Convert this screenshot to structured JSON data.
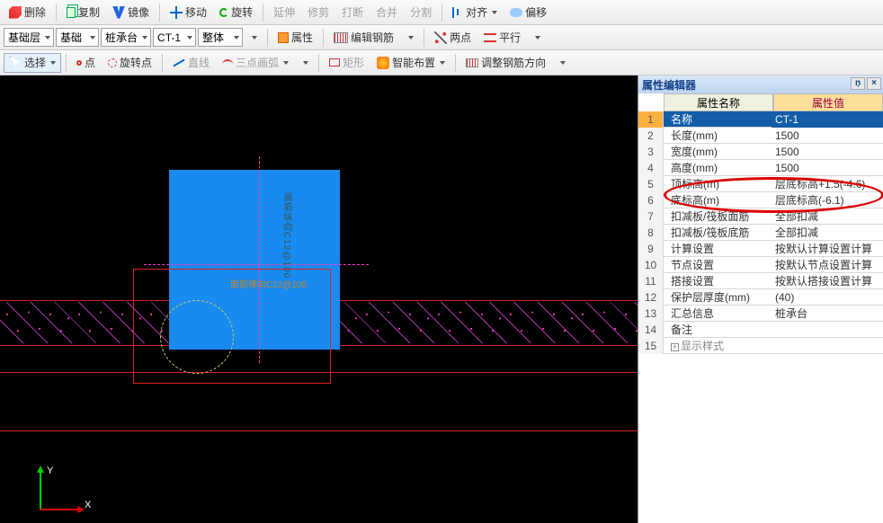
{
  "toolbar1": {
    "delete": "删除",
    "copy": "复制",
    "mirror": "镜像",
    "move": "移动",
    "rotate": "旋转",
    "extend": "延伸",
    "trim": "修剪",
    "break": "打断",
    "merge": "合并",
    "split": "分割",
    "align": "对齐",
    "offset": "偏移"
  },
  "toolbar2": {
    "layer": "基础层",
    "cat": "基础",
    "sub": "桩承台",
    "name": "CT-1",
    "scope": "整体",
    "prop": "属性",
    "editrebar": "编辑钢筋",
    "twopoint": "两点",
    "parallel": "平行"
  },
  "toolbar3": {
    "select": "选择",
    "point": "点",
    "rotpoint": "旋转点",
    "line": "直线",
    "arc": "三点画弧",
    "rect": "矩形",
    "smart": "智能布置",
    "rebardir": "调整钢筋方向"
  },
  "panel": {
    "title": "属性编辑器",
    "col_name": "属性名称",
    "col_value": "属性值",
    "rows": [
      {
        "i": "1",
        "n": "名称",
        "v": "CT-1",
        "sel": true
      },
      {
        "i": "2",
        "n": "长度(mm)",
        "v": "1500"
      },
      {
        "i": "3",
        "n": "宽度(mm)",
        "v": "1500"
      },
      {
        "i": "4",
        "n": "高度(mm)",
        "v": "1500"
      },
      {
        "i": "5",
        "n": "顶标高(m)",
        "v": "层底标高+1.5(-4.6)"
      },
      {
        "i": "6",
        "n": "底标高(m)",
        "v": "层底标高(-6.1)"
      },
      {
        "i": "7",
        "n": "扣减板/筏板面筋",
        "v": "全部扣减"
      },
      {
        "i": "8",
        "n": "扣减板/筏板底筋",
        "v": "全部扣减"
      },
      {
        "i": "9",
        "n": "计算设置",
        "v": "按默认计算设置计算"
      },
      {
        "i": "10",
        "n": "节点设置",
        "v": "按默认节点设置计算"
      },
      {
        "i": "11",
        "n": "搭接设置",
        "v": "按默认搭接设置计算"
      },
      {
        "i": "12",
        "n": "保护层厚度(mm)",
        "v": "(40)"
      },
      {
        "i": "13",
        "n": "汇总信息",
        "v": "桩承台"
      },
      {
        "i": "14",
        "n": "备注",
        "v": ""
      },
      {
        "i": "15",
        "n": "显示样式",
        "v": "",
        "expand": true
      }
    ]
  },
  "canvas": {
    "axis_y": "Y",
    "axis_x": "X",
    "label": "面筋横向C12@100",
    "vlabel": "面筋纵向C12@100"
  }
}
